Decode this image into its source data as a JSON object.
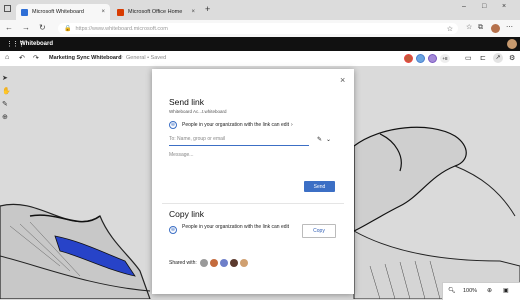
{
  "browser": {
    "tabs": [
      {
        "label": "Microsoft Whiteboard",
        "color": "#2f6fd6"
      },
      {
        "label": "Microsoft Office Home",
        "color": "#d83b01"
      }
    ],
    "new_tab": "+",
    "url": "https://www.whiteboard.microsoft.com"
  },
  "app": {
    "title": "Whiteboard"
  },
  "toolbar": {
    "board_name": "Marketing Sync Whiteboard",
    "sensitivity": "General • Saved",
    "participant_count": "+8"
  },
  "dialog": {
    "close": "×",
    "send_title": "Send link",
    "send_subtitle": "Whiteboard Ac...t.whiteboard",
    "permission": "People in your organization with the link can edit",
    "to_placeholder": "To: Name, group or email",
    "message_placeholder": "Message...",
    "send_button": "Send",
    "copy_title": "Copy link",
    "copy_permission": "People in your organization with the link can edit",
    "copy_button": "Copy",
    "shared_with": "Shared with:"
  },
  "zoom": {
    "level": "100%"
  },
  "colors": {
    "accent": "#3c6fc5",
    "header": "#111111"
  }
}
